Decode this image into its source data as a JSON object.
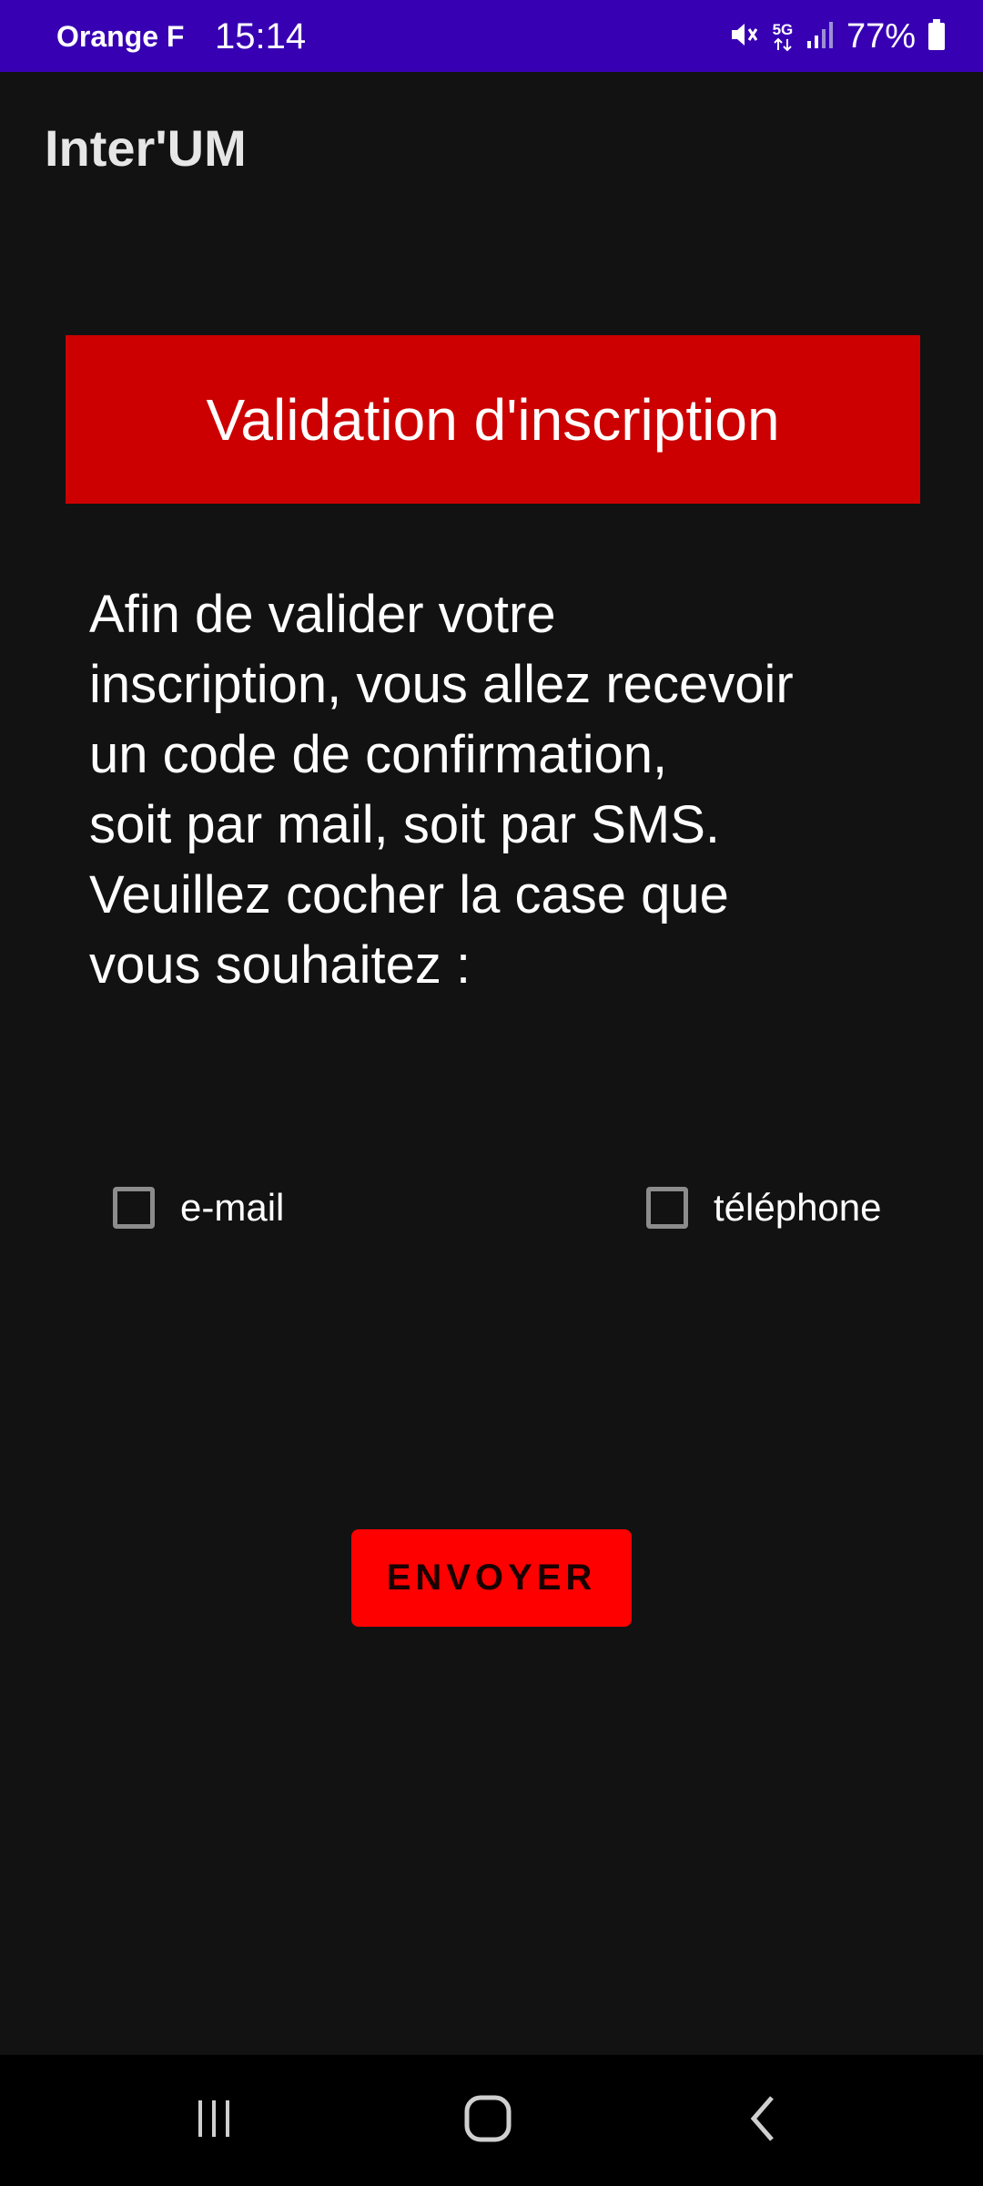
{
  "status_bar": {
    "carrier": "Orange F",
    "time": "15:14",
    "network": "5G",
    "battery": "77%",
    "icons": [
      "mute-icon",
      "5g-icon",
      "signal-icon",
      "battery-icon"
    ]
  },
  "app": {
    "title": "Inter'UM"
  },
  "banner": {
    "title": "Validation d'inscription",
    "color": "#cc0000"
  },
  "instructions": {
    "text": "Afin de valider votre\ninscription, vous allez recevoir\nun code de confirmation,\nsoit par mail, soit par SMS.\nVeuillez cocher la case que\nvous souhaitez :"
  },
  "options": {
    "email": {
      "label": "e-mail",
      "checked": false
    },
    "phone": {
      "label": "téléphone",
      "checked": false
    }
  },
  "send_button": {
    "label": "ENVOYER",
    "color": "#ff0000"
  },
  "nav_bar": {
    "icons": [
      "recent-apps-icon",
      "home-icon",
      "back-icon"
    ]
  },
  "colors": {
    "status_bar": "#3700b3",
    "background": "#121212"
  }
}
